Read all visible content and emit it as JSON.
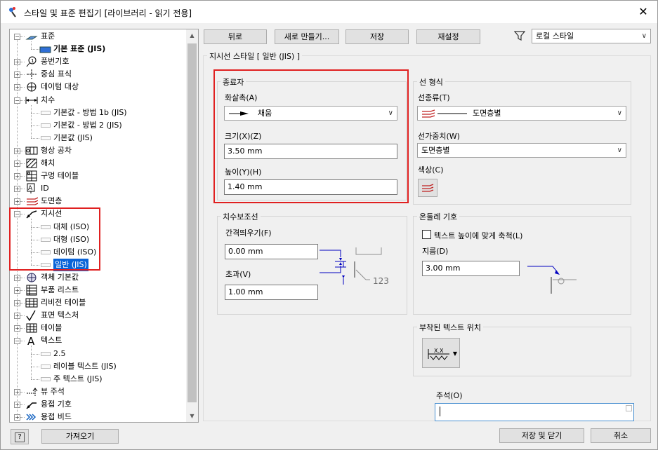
{
  "window": {
    "title": "스타일 및 표준 편집기 [라이브러리 - 읽기 전용]"
  },
  "tree": {
    "items": [
      {
        "label": "표준",
        "level": 0,
        "expanded": true,
        "icon": "standard-icon"
      },
      {
        "label": "기본 표준 (JIS)",
        "level": 1,
        "bold": true,
        "icon": "standard-doc-icon"
      },
      {
        "label": "풍번기호",
        "level": 0,
        "icon": "balloon-icon"
      },
      {
        "label": "중심 표식",
        "level": 0,
        "icon": "center-mark-icon"
      },
      {
        "label": "데이텀 대상",
        "level": 0,
        "icon": "datum-target-icon"
      },
      {
        "label": "치수",
        "level": 0,
        "expanded": true,
        "icon": "dimension-icon"
      },
      {
        "label": "기본값 - 방법 1b (JIS)",
        "level": 1
      },
      {
        "label": "기본값 - 방법 2 (JIS)",
        "level": 1
      },
      {
        "label": "기본값 (JIS)",
        "level": 1
      },
      {
        "label": "형상 공차",
        "level": 0,
        "icon": "feature-control-icon"
      },
      {
        "label": "해치",
        "level": 0,
        "icon": "hatch-icon"
      },
      {
        "label": "구멍 테이블",
        "level": 0,
        "icon": "hole-table-icon"
      },
      {
        "label": "ID",
        "level": 0,
        "icon": "id-icon"
      },
      {
        "label": "도면층",
        "level": 0,
        "icon": "layers-icon"
      },
      {
        "label": "지시선",
        "level": 0,
        "expanded": true,
        "icon": "leader-icon"
      },
      {
        "label": "대체 (ISO)",
        "level": 1
      },
      {
        "label": "대형 (ISO)",
        "level": 1
      },
      {
        "label": "데이텀 (ISO)",
        "level": 1
      },
      {
        "label": "일반 (JIS)",
        "level": 1,
        "selected": true
      },
      {
        "label": "객체 기본값",
        "level": 0,
        "icon": "object-defaults-icon"
      },
      {
        "label": "부품 리스트",
        "level": 0,
        "icon": "parts-list-icon"
      },
      {
        "label": "리비전 테이블",
        "level": 0,
        "icon": "revision-table-icon"
      },
      {
        "label": "표면 텍스처",
        "level": 0,
        "icon": "surface-texture-icon"
      },
      {
        "label": "테이블",
        "level": 0,
        "icon": "table-icon"
      },
      {
        "label": "텍스트",
        "level": 0,
        "expanded": true,
        "icon": "text-icon"
      },
      {
        "label": "2.5",
        "level": 1
      },
      {
        "label": "레이블 텍스트 (JIS)",
        "level": 1
      },
      {
        "label": "주 텍스트 (JIS)",
        "level": 1
      },
      {
        "label": "뷰 주석",
        "level": 0,
        "icon": "view-annotation-icon"
      },
      {
        "label": "용접 기호",
        "level": 0,
        "icon": "weld-symbol-icon"
      },
      {
        "label": "용접 비드",
        "level": 0,
        "icon": "weld-bead-icon"
      }
    ]
  },
  "toolbar": {
    "back_label": "뒤로",
    "new_label": "새로 만들기...",
    "save_label": "저장",
    "reset_label": "재설정",
    "filter_value": "로컬 스타일"
  },
  "panel": {
    "title": "지시선 스타일 [ 일반 (JIS) ]",
    "terminator": {
      "group_label": "종료자",
      "arrowhead_label": "화살촉(A)",
      "arrowhead_value": "채움",
      "size_label": "크기(X)(Z)",
      "size_value": "3.50 mm",
      "height_label": "높이(Y)(H)",
      "height_value": "1.40 mm"
    },
    "line_format": {
      "group_label": "선 형식",
      "linetype_label": "선종류(T)",
      "linetype_value": "도면층별",
      "lineweight_label": "선가중치(W)",
      "lineweight_value": "도면층별",
      "color_label": "색상(C)"
    },
    "extension": {
      "group_label": "치수보조선",
      "gap_label": "간격띄우기(F)",
      "gap_value": "0.00 mm",
      "extend_label": "초과(V)",
      "extend_value": "1.00 mm",
      "preview_text": "123"
    },
    "landing": {
      "group_label": "온둘레 기호",
      "scale_checkbox_label": "텍스트 높이에 맞게 축척(L)",
      "diameter_label": "지름(D)",
      "diameter_value": "3.00 mm"
    },
    "attached_text": {
      "group_label": "부착된 텍스트 위치"
    },
    "comment_label": "주석(O)"
  },
  "footer": {
    "help_label": "?",
    "import_label": "가져오기",
    "save_close_label": "저장 및 닫기",
    "cancel_label": "취소"
  },
  "colors": {
    "selection": "#0a64d8",
    "highlight_box": "#e02020",
    "arrow_blue": "#0000c0"
  }
}
